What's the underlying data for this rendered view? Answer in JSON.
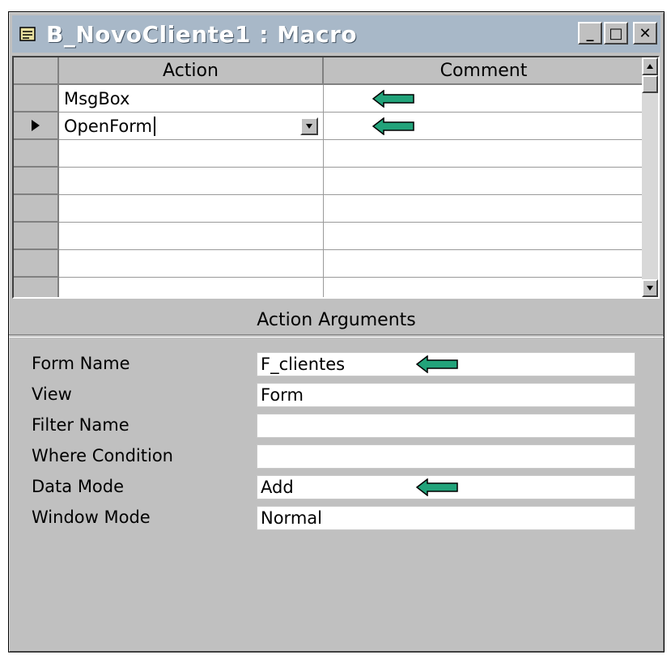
{
  "window": {
    "title": "B_NovoCliente1 : Macro",
    "minimize_label": "_",
    "maximize_label": "□",
    "close_label": "✕"
  },
  "grid": {
    "columns": {
      "action": "Action",
      "comment": "Comment"
    },
    "rows": [
      {
        "action": "MsgBox",
        "comment": "",
        "current": false,
        "comment_arrow": true
      },
      {
        "action": "OpenForm",
        "comment": "",
        "current": true,
        "comment_arrow": true
      },
      {
        "action": "",
        "comment": ""
      },
      {
        "action": "",
        "comment": ""
      },
      {
        "action": "",
        "comment": ""
      },
      {
        "action": "",
        "comment": ""
      },
      {
        "action": "",
        "comment": ""
      },
      {
        "action": "",
        "comment": ""
      }
    ]
  },
  "arguments": {
    "title": "Action Arguments",
    "fields": [
      {
        "label": "Form Name",
        "value": "F_clientes",
        "arrow": true
      },
      {
        "label": "View",
        "value": "Form"
      },
      {
        "label": "Filter Name",
        "value": ""
      },
      {
        "label": "Where Condition",
        "value": ""
      },
      {
        "label": "Data Mode",
        "value": "Add",
        "arrow": true
      },
      {
        "label": "Window Mode",
        "value": "Normal"
      }
    ]
  },
  "colors": {
    "arrow_fill": "#22a37a",
    "titlebar": "#a8b8c8",
    "window": "#c0c0c0"
  },
  "icons": [
    "macro-icon",
    "minimize-icon",
    "maximize-icon",
    "close-icon",
    "row-pointer-icon",
    "dropdown-arrow-icon",
    "scroll-up-icon",
    "scroll-down-icon",
    "left-arrow-icon"
  ]
}
